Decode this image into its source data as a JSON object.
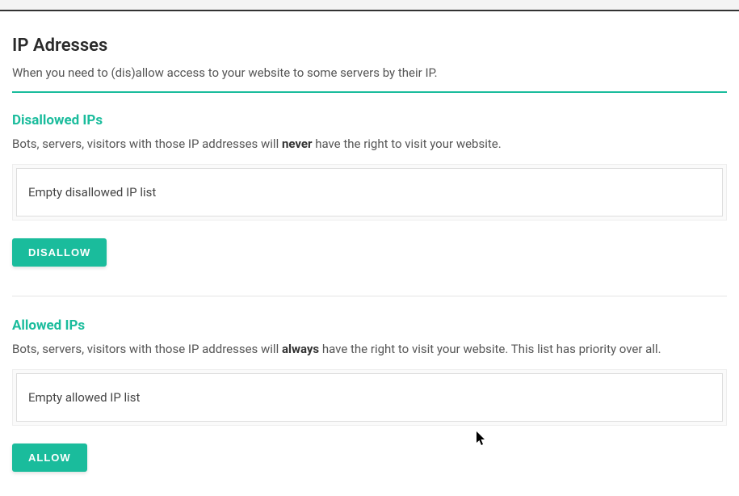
{
  "page": {
    "title": "IP Adresses",
    "subtitle": "When you need to (dis)allow access to your website to some servers by their IP."
  },
  "disallowed": {
    "title": "Disallowed IPs",
    "desc_pre": "Bots, servers, visitors with those IP addresses will ",
    "desc_emph": "never",
    "desc_post": " have the right to visit your website.",
    "list_placeholder": "Empty disallowed IP list",
    "button_label": "DISALLOW"
  },
  "allowed": {
    "title": "Allowed IPs",
    "desc_pre": "Bots, servers, visitors with those IP addresses will ",
    "desc_emph": "always",
    "desc_post": " have the right to visit your website. This list has priority over all.",
    "list_placeholder": "Empty allowed IP list",
    "button_label": "ALLOW"
  }
}
